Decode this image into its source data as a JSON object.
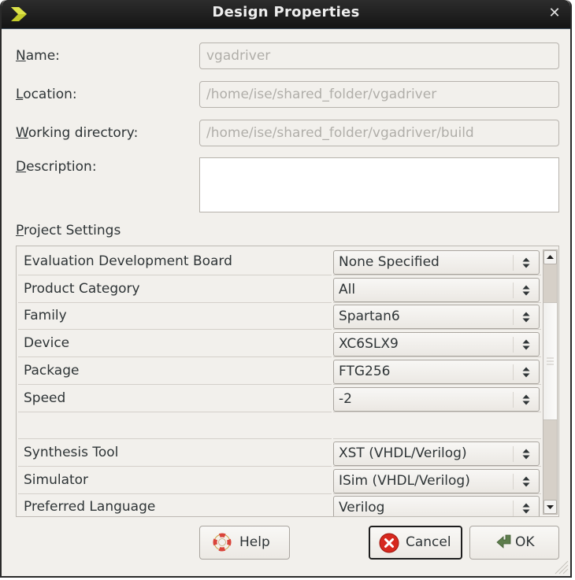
{
  "window": {
    "title": "Design Properties",
    "close_icon": "close-icon",
    "app_icon": "xilinx-chevron-icon"
  },
  "form": {
    "name": {
      "label_mnemonic": "N",
      "label_rest": "ame:",
      "value": "vgadriver"
    },
    "location": {
      "label_mnemonic": "L",
      "label_rest": "ocation:",
      "value": "/home/ise/shared_folder/vgadriver"
    },
    "working_directory": {
      "label_mnemonic": "W",
      "label_rest": "orking directory:",
      "value": "/home/ise/shared_folder/vgadriver/build"
    },
    "description": {
      "label_mnemonic": "D",
      "label_rest": "escription:",
      "value": ""
    },
    "project_settings_label": {
      "mnemonic": "P",
      "rest": "roject Settings"
    }
  },
  "settings": {
    "rows": [
      {
        "name": "Evaluation Development Board",
        "value": "None Specified"
      },
      {
        "name": "Product Category",
        "value": "All"
      },
      {
        "name": "Family",
        "value": "Spartan6"
      },
      {
        "name": "Device",
        "value": "XC6SLX9"
      },
      {
        "name": "Package",
        "value": "FTG256"
      },
      {
        "name": "Speed",
        "value": "-2"
      },
      {
        "name": "",
        "value": ""
      },
      {
        "name": "Synthesis Tool",
        "value": "XST (VHDL/Verilog)"
      },
      {
        "name": "Simulator",
        "value": "ISim (VHDL/Verilog)"
      },
      {
        "name": "Preferred Language",
        "value": "Verilog"
      }
    ],
    "scroll_position": 0.2
  },
  "buttons": {
    "help": "Help",
    "cancel": "Cancel",
    "ok": "OK"
  },
  "colors": {
    "titlebar": "#1c1c1c",
    "background": "#f2f0ec",
    "cancel_icon": "#d8261c",
    "ok_icon": "#5a7a4a",
    "help_icon": "#d84a3a",
    "app_icon": "#c8d02c"
  }
}
